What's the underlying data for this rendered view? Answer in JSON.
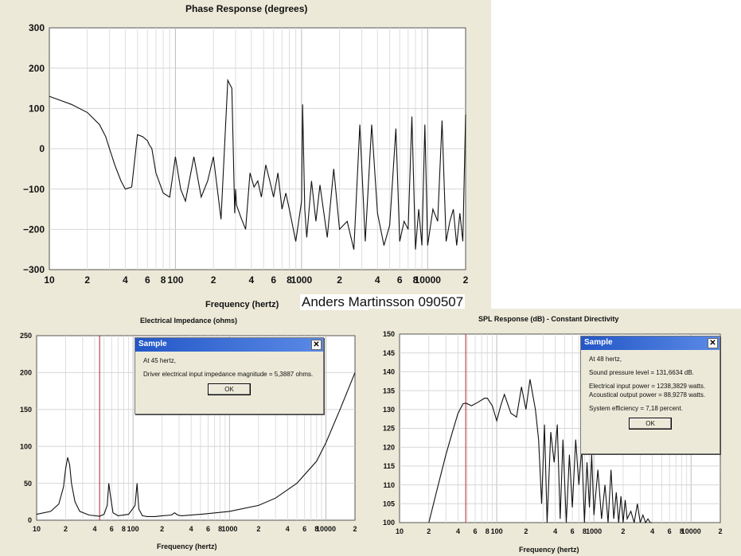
{
  "phase_chart": {
    "title": "Phase Response (degrees)",
    "xlabel": "Frequency (hertz)",
    "y_ticks": [
      "300",
      "200",
      "100",
      "0",
      "−100",
      "−200",
      "−300"
    ],
    "x_ticks": [
      "10",
      "2",
      "4",
      "6",
      "8",
      "100",
      "2",
      "4",
      "6",
      "8",
      "1000",
      "2",
      "4",
      "6",
      "8",
      "10000",
      "2"
    ]
  },
  "author_note": "Anders Martinsson 090507",
  "impedance_chart": {
    "title": "Electrical Impedance (ohms)",
    "xlabel": "Frequency (hertz)",
    "y_ticks": [
      "250",
      "200",
      "150",
      "100",
      "50",
      "0"
    ],
    "x_ticks": [
      "10",
      "2",
      "4",
      "6",
      "8",
      "100",
      "2",
      "4",
      "6",
      "8",
      "1000",
      "2",
      "4",
      "6",
      "8",
      "10000",
      "2"
    ],
    "dialog": {
      "title": "Sample",
      "line1": "At 45 hertz,",
      "line2": "Driver electrical input impedance magnitude = 5,3887 ohms.",
      "ok_label": "OK",
      "close_glyph": "✕"
    }
  },
  "spl_chart": {
    "title": "SPL Response (dB) - Constant Directivity",
    "xlabel": "Frequency (hertz)",
    "y_ticks": [
      "150",
      "145",
      "140",
      "135",
      "130",
      "125",
      "120",
      "115",
      "110",
      "105",
      "100"
    ],
    "x_ticks": [
      "10",
      "2",
      "4",
      "6",
      "8",
      "100",
      "2",
      "4",
      "6",
      "8",
      "1000",
      "2",
      "4",
      "6",
      "8",
      "10000",
      "2"
    ],
    "dialog": {
      "title": "Sample",
      "line1": "At 48 hertz,",
      "line2": "Sound pressure level = 131,6634 dB.",
      "line3": "Electrical input power = 1238,3829 watts.",
      "line4": "Acoustical output power = 88,9278 watts.",
      "line5": "System efficiency = 7,18 percent.",
      "ok_label": "OK",
      "close_glyph": "✕"
    }
  },
  "chart_data": [
    {
      "type": "line",
      "title": "Phase Response (degrees)",
      "xlabel": "Frequency (hertz)",
      "ylabel": "",
      "x_scale": "log",
      "xlim": [
        10,
        20000
      ],
      "ylim": [
        -300,
        300
      ],
      "grid": true,
      "series": [
        {
          "x": [
            10,
            15,
            20,
            25,
            28,
            30,
            33,
            37,
            40,
            45,
            50,
            55,
            60,
            62,
            65,
            70,
            80,
            90,
            100,
            110,
            120,
            140,
            160,
            180,
            200,
            230,
            260,
            280,
            295,
            300,
            305,
            330,
            360,
            390,
            420,
            450,
            480,
            520,
            560,
            600,
            650,
            700,
            750,
            800,
            900,
            1000,
            1020,
            1060,
            1100,
            1200,
            1300,
            1400,
            1600,
            1800,
            2000,
            2300,
            2600,
            2900,
            3200,
            3600,
            4000,
            4500,
            5000,
            5600,
            6000,
            6500,
            7000,
            7500,
            8000,
            8500,
            9000,
            9500,
            10000,
            11000,
            12000,
            13000,
            14000,
            15000,
            16000,
            17000,
            18000,
            19000,
            20000
          ],
          "values": [
            130,
            110,
            90,
            60,
            30,
            0,
            -40,
            -80,
            -100,
            -95,
            35,
            30,
            20,
            10,
            0,
            -60,
            -110,
            -120,
            -20,
            -100,
            -130,
            -20,
            -120,
            -80,
            -20,
            -175,
            170,
            150,
            -160,
            -100,
            -140,
            -170,
            -200,
            -60,
            -95,
            -80,
            -120,
            -40,
            -80,
            -120,
            -60,
            -150,
            -110,
            -150,
            -230,
            -130,
            110,
            -150,
            -220,
            -80,
            -180,
            -90,
            -220,
            -50,
            -200,
            -180,
            -250,
            60,
            -230,
            60,
            -160,
            -240,
            -190,
            50,
            -230,
            -180,
            -200,
            80,
            -250,
            -150,
            -240,
            60,
            -240,
            -150,
            -180,
            70,
            -230,
            -180,
            -150,
            -240,
            -160,
            -230,
            85
          ]
        }
      ]
    },
    {
      "type": "line",
      "title": "Electrical Impedance (ohms)",
      "xlabel": "Frequency (hertz)",
      "ylabel": "",
      "x_scale": "log",
      "xlim": [
        10,
        20000
      ],
      "ylim": [
        0,
        250
      ],
      "grid": true,
      "series": [
        {
          "x": [
            10,
            14,
            17,
            19,
            20,
            21,
            22,
            23,
            25,
            28,
            35,
            45,
            50,
            54,
            56,
            58,
            62,
            70,
            90,
            105,
            110,
            112,
            115,
            125,
            140,
            170,
            200,
            250,
            270,
            290,
            320,
            500,
            1000,
            2000,
            3000,
            5000,
            8000,
            10000,
            14000,
            20000
          ],
          "values": [
            8,
            12,
            22,
            45,
            70,
            85,
            75,
            50,
            25,
            12,
            7,
            5.4,
            8,
            20,
            50,
            35,
            10,
            6,
            8,
            20,
            50,
            35,
            15,
            6,
            5,
            5,
            6,
            7,
            10,
            7,
            6,
            8,
            12,
            20,
            30,
            50,
            80,
            105,
            150,
            200
          ]
        }
      ],
      "marker_x": 45
    },
    {
      "type": "line",
      "title": "SPL Response (dB) - Constant Directivity",
      "xlabel": "Frequency (hertz)",
      "ylabel": "",
      "x_scale": "log",
      "xlim": [
        10,
        20000
      ],
      "ylim": [
        100,
        150
      ],
      "grid": true,
      "series": [
        {
          "x": [
            20,
            25,
            30,
            35,
            40,
            45,
            48,
            55,
            65,
            75,
            80,
            90,
            100,
            110,
            120,
            140,
            160,
            180,
            200,
            220,
            250,
            270,
            290,
            310,
            330,
            360,
            390,
            420,
            450,
            480,
            520,
            560,
            600,
            650,
            700,
            750,
            800,
            850,
            900,
            950,
            1000,
            1100,
            1200,
            1300,
            1400,
            1500,
            1600,
            1700,
            1800,
            1900,
            2000,
            2100,
            2200,
            2400,
            2600,
            2800,
            3000,
            3200,
            3400,
            3600,
            3800,
            4000
          ],
          "values": [
            100,
            110,
            118,
            124,
            129,
            131.5,
            131.7,
            131,
            132,
            133,
            133,
            131,
            127,
            131,
            134,
            129,
            128,
            136,
            130,
            138,
            130,
            122,
            105,
            126,
            100,
            124,
            116,
            126,
            101,
            122,
            100,
            118,
            104,
            122,
            110,
            120,
            100,
            116,
            104,
            118,
            102,
            114,
            101,
            110,
            100,
            114,
            101,
            108,
            100,
            107,
            100,
            106,
            101,
            103,
            100,
            105,
            100,
            102,
            100,
            101,
            100,
            100
          ]
        }
      ],
      "marker_x": 48
    }
  ]
}
